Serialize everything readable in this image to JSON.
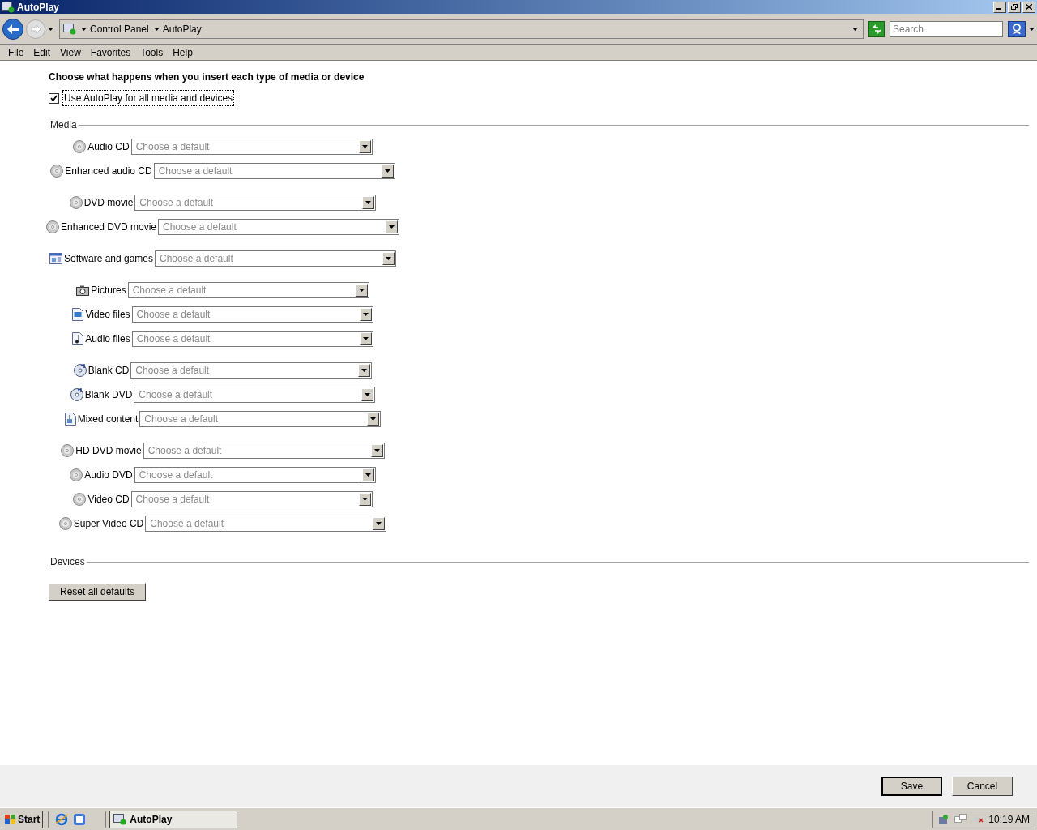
{
  "window": {
    "title": "AutoPlay"
  },
  "address_bar": {
    "path": [
      "Control Panel",
      "AutoPlay"
    ]
  },
  "search": {
    "placeholder": "Search"
  },
  "menu": [
    "File",
    "Edit",
    "View",
    "Favorites",
    "Tools",
    "Help"
  ],
  "heading": "Choose what happens when you insert each type of media or device",
  "use_autoplay": {
    "label": "Use AutoPlay for all media and devices",
    "checked": true
  },
  "media_section": {
    "title": "Media",
    "groups": [
      [
        {
          "kind": "disc",
          "label": "Audio CD",
          "placeholder": "Choose a default"
        },
        {
          "kind": "disc",
          "label": "Enhanced audio CD",
          "placeholder": "Choose a default"
        }
      ],
      [
        {
          "kind": "disc",
          "label": "DVD movie",
          "placeholder": "Choose a default"
        },
        {
          "kind": "disc",
          "label": "Enhanced DVD movie",
          "placeholder": "Choose a default"
        }
      ],
      [
        {
          "kind": "software",
          "label": "Software and games",
          "placeholder": "Choose a default"
        }
      ],
      [
        {
          "kind": "pictures",
          "label": "Pictures",
          "placeholder": "Choose a default"
        },
        {
          "kind": "video",
          "label": "Video files",
          "placeholder": "Choose a default"
        },
        {
          "kind": "audio",
          "label": "Audio files",
          "placeholder": "Choose a default"
        }
      ],
      [
        {
          "kind": "blank",
          "label": "Blank CD",
          "placeholder": "Choose a default"
        },
        {
          "kind": "blank",
          "label": "Blank DVD",
          "placeholder": "Choose a default"
        },
        {
          "kind": "mixed",
          "label": "Mixed content",
          "placeholder": "Choose a default"
        }
      ],
      [
        {
          "kind": "disc",
          "label": "HD DVD movie",
          "placeholder": "Choose a default"
        },
        {
          "kind": "disc",
          "label": "Audio DVD",
          "placeholder": "Choose a default"
        },
        {
          "kind": "disc",
          "label": "Video CD",
          "placeholder": "Choose a default"
        },
        {
          "kind": "disc",
          "label": "Super Video CD",
          "placeholder": "Choose a default"
        }
      ]
    ]
  },
  "devices_section": {
    "title": "Devices"
  },
  "reset_button": "Reset all defaults",
  "buttons": [
    {
      "label": "Save",
      "default": true
    },
    {
      "label": "Cancel",
      "default": false
    }
  ],
  "taskbar": {
    "start": "Start",
    "tasks": [
      {
        "label": "AutoPlay",
        "selected": true
      }
    ],
    "clock": "10:19 AM"
  }
}
